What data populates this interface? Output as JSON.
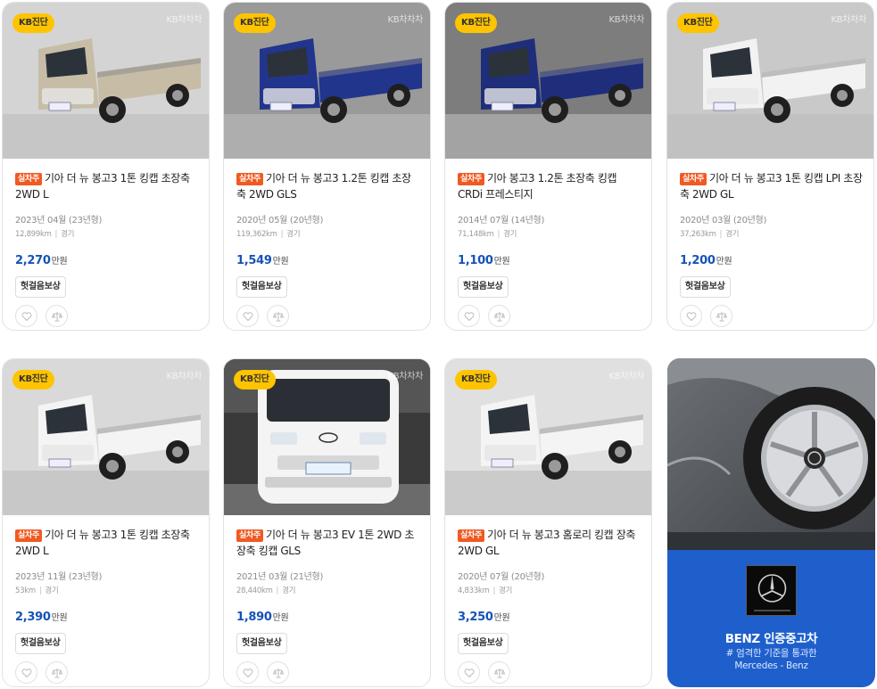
{
  "listings": [
    {
      "badge": "KB진단",
      "watermark": "KB차차차",
      "tag": "실차주",
      "title": "기아 더 뉴 봉고3 1톤 킹캡 초장축 2WD L",
      "year": "2023년 04월 (23년형)",
      "mileage": "12,899km",
      "region": "경기",
      "price": "2,270",
      "price_unit": "만원",
      "chip": "헛걸음보상",
      "truck_color": "#c7bca6",
      "bg_color": "#d4d4d4"
    },
    {
      "badge": "KB진단",
      "watermark": "KB차차차",
      "tag": "실차주",
      "title": "기아 더 뉴 봉고3 1.2톤 킹캡 초장축 2WD GLS",
      "year": "2020년 05월 (20년형)",
      "mileage": "119,362km",
      "region": "경기",
      "price": "1,549",
      "price_unit": "만원",
      "chip": "헛걸음보상",
      "truck_color": "#22358c",
      "bg_color": "#9a9a9a"
    },
    {
      "badge": "KB진단",
      "watermark": "KB차차차",
      "tag": "실차주",
      "title": "기아 봉고3 1.2톤 초장축 킹캡 CRDi 프레스티지",
      "year": "2014년 07월 (14년형)",
      "mileage": "71,148km",
      "region": "경기",
      "price": "1,100",
      "price_unit": "만원",
      "chip": "헛걸음보상",
      "truck_color": "#1f2e7a",
      "bg_color": "#7d7d7d"
    },
    {
      "badge": "KB진단",
      "watermark": "KB차차차",
      "tag": "실차주",
      "title": "기아 더 뉴 봉고3 1톤 킹캡 LPI 초장축 2WD GL",
      "year": "2020년 03월 (20년형)",
      "mileage": "37,263km",
      "region": "경기",
      "price": "1,200",
      "price_unit": "만원",
      "chip": "헛걸음보상",
      "truck_color": "#f2f2f2",
      "bg_color": "#c9c9c9"
    },
    {
      "badge": "KB진단",
      "watermark": "KB차차차",
      "tag": "실차주",
      "title": "기아 더 뉴 봉고3 1톤 킹캡 초장축 2WD L",
      "year": "2023년 11월 (23년형)",
      "mileage": "53km",
      "region": "경기",
      "price": "2,390",
      "price_unit": "만원",
      "chip": "헛걸음보상",
      "truck_color": "#f4f4f4",
      "bg_color": "#d9d9d9"
    },
    {
      "badge": "KB진단",
      "watermark": "KB차차차",
      "tag": "실차주",
      "title": "기아 더 뉴 봉고3 EV 1톤 2WD 초장축 킹캡 GLS",
      "year": "2021년 03월 (21년형)",
      "mileage": "28,440km",
      "region": "경기",
      "price": "1,890",
      "price_unit": "만원",
      "chip": "헛걸음보상",
      "truck_color": "#f4f4f4",
      "bg_color": "#3a3a3a",
      "plate": "90우 0967"
    },
    {
      "badge": "KB진단",
      "watermark": "KB차차차",
      "tag": "실차주",
      "title": "기아 더 뉴 봉고3 홈로리 킹캡 장축 2WD GL",
      "year": "2020년 07월 (20년형)",
      "mileage": "4,833km",
      "region": "경기",
      "price": "3,250",
      "price_unit": "만원",
      "chip": "헛걸음보상",
      "truck_color": "#f4f4f4",
      "bg_color": "#e0e0e0"
    }
  ],
  "ad": {
    "title": "BENZ 인증중고차",
    "subtitle": "# 엄격한 기준을 통과한",
    "brand": "Mercedes - Benz",
    "bg_color": "#1e5fcc"
  },
  "colors": {
    "accent_price": "#1553b8",
    "tag": "#f05a22",
    "badge": "#ffc400"
  }
}
